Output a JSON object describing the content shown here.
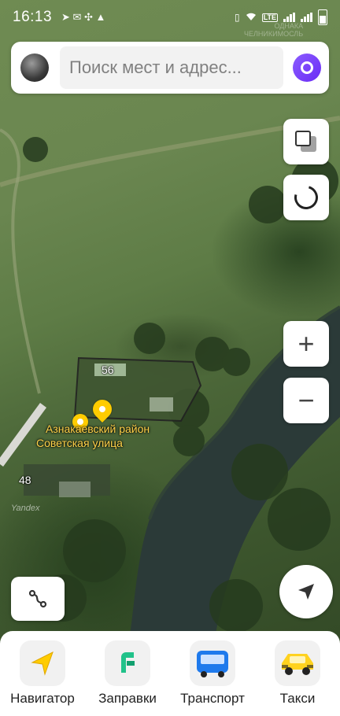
{
  "status_bar": {
    "time": "16:13",
    "notifications": "➤ ✉ ✣ ▲",
    "network": "LTE",
    "icons": [
      "vibrate-icon",
      "wifi-icon",
      "signal-icon",
      "battery-icon"
    ]
  },
  "watermark": {
    "line1": "ОДНАКА",
    "line2": "ЧЕЛНИКИМОСЛЬ"
  },
  "search": {
    "placeholder": "Поиск мест и адрес..."
  },
  "map": {
    "building_numbers": [
      "56",
      "48"
    ],
    "place": {
      "district": "Азнакаевский район",
      "street": "Советская улица"
    },
    "copyright": "Yandex"
  },
  "controls": {
    "zoom_in": "+",
    "zoom_out": "−",
    "icons": [
      "layers-icon",
      "alice-circle-icon",
      "route-icon",
      "locate-arrow-icon"
    ]
  },
  "bottom_apps": [
    {
      "label": "Навигатор",
      "icon": "navigator-arrow-icon",
      "color": "#ffcc00"
    },
    {
      "label": "Заправки",
      "icon": "fuel-icon",
      "color": "#21c28a"
    },
    {
      "label": "Транспорт",
      "icon": "bus-icon",
      "color": "#1f7aec"
    },
    {
      "label": "Такси",
      "icon": "taxi-car-icon",
      "color": "#ffd21f"
    }
  ],
  "colors": {
    "accent_purple": "#7a3cff",
    "pin_yellow": "#ffcc00"
  }
}
